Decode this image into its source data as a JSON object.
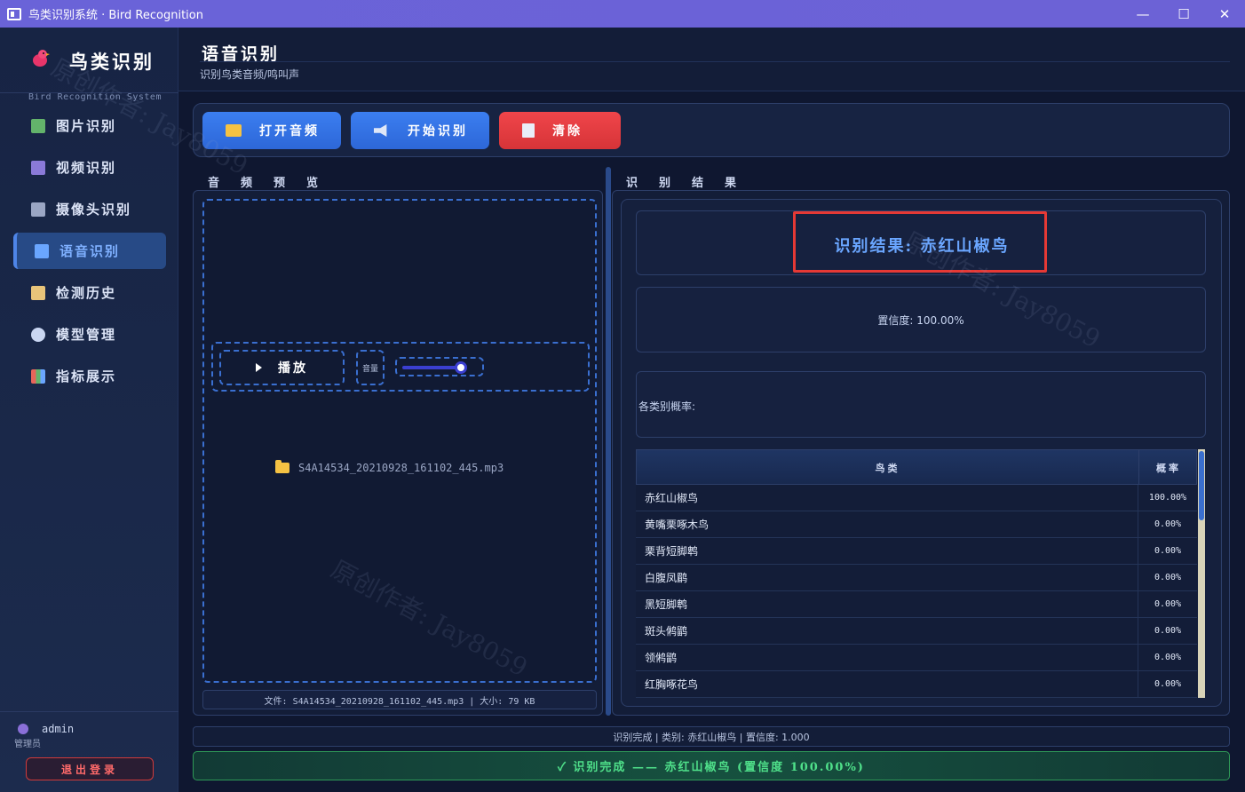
{
  "window": {
    "title": "鸟类识别系统 · Bird Recognition",
    "minimize": "—",
    "maximize": "☐",
    "close": "✕"
  },
  "sidebar": {
    "logo_title": "鸟类识别",
    "logo_subtitle": "Bird Recognition System",
    "items": [
      {
        "label": "图片识别",
        "icon": "image-icon",
        "color": "#63b36b"
      },
      {
        "label": "视频识别",
        "icon": "clapperboard-icon",
        "color": "#8a7ad8"
      },
      {
        "label": "摄像头识别",
        "icon": "camera-icon",
        "color": "#9aa6c4"
      },
      {
        "label": "语音识别",
        "icon": "speaker-icon",
        "color": "#6aa6ff",
        "active": true
      },
      {
        "label": "检测历史",
        "icon": "clipboard-icon",
        "color": "#e8c47a"
      },
      {
        "label": "模型管理",
        "icon": "gear-icon",
        "color": "#c9d6f2"
      },
      {
        "label": "指标展示",
        "icon": "bar-chart-icon",
        "color": "#e8655a"
      }
    ],
    "user": {
      "name": "admin",
      "role": "管理员"
    },
    "logout_label": "退出登录"
  },
  "header": {
    "title": "语音识别",
    "subtitle": "识别鸟类音频/鸣叫声"
  },
  "toolbar": {
    "open_label": "打开音频",
    "start_label": "开始识别",
    "clear_label": "清除"
  },
  "preview": {
    "section_label": "音频预览",
    "play_label": "播放",
    "volume_label": "音量",
    "volume_level": 0.8,
    "file_name": "S4A14534_20210928_161102_445.mp3",
    "file_info": "文件: S4A14534_20210928_161102_445.mp3  |  大小: 79 KB"
  },
  "result": {
    "section_label": "识别结果",
    "result_text": "识别结果: 赤红山椒鸟",
    "confidence_text": "置信度: 100.00%",
    "prob_label": "各类别概率:",
    "table_headers": [
      "鸟类",
      "概率"
    ],
    "rows": [
      {
        "name": "赤红山椒鸟",
        "prob": "100.00%"
      },
      {
        "name": "黄嘴栗啄木鸟",
        "prob": "0.00%"
      },
      {
        "name": "栗背短脚鹎",
        "prob": "0.00%"
      },
      {
        "name": "白腹凤鹛",
        "prob": "0.00%"
      },
      {
        "name": "黑短脚鹎",
        "prob": "0.00%"
      },
      {
        "name": "斑头鸺鹠",
        "prob": "0.00%"
      },
      {
        "name": "领鸺鹠",
        "prob": "0.00%"
      },
      {
        "name": "红胸啄花鸟",
        "prob": "0.00%"
      }
    ],
    "highlight_color": "#e53935"
  },
  "status": {
    "status_text": "识别完成 | 类别: 赤红山椒鸟 | 置信度: 1.000",
    "success_text": "✓ 识别完成 —— 赤红山椒鸟 (置信度 100.00%)"
  },
  "watermark_text": "原创作者: Jay8059"
}
